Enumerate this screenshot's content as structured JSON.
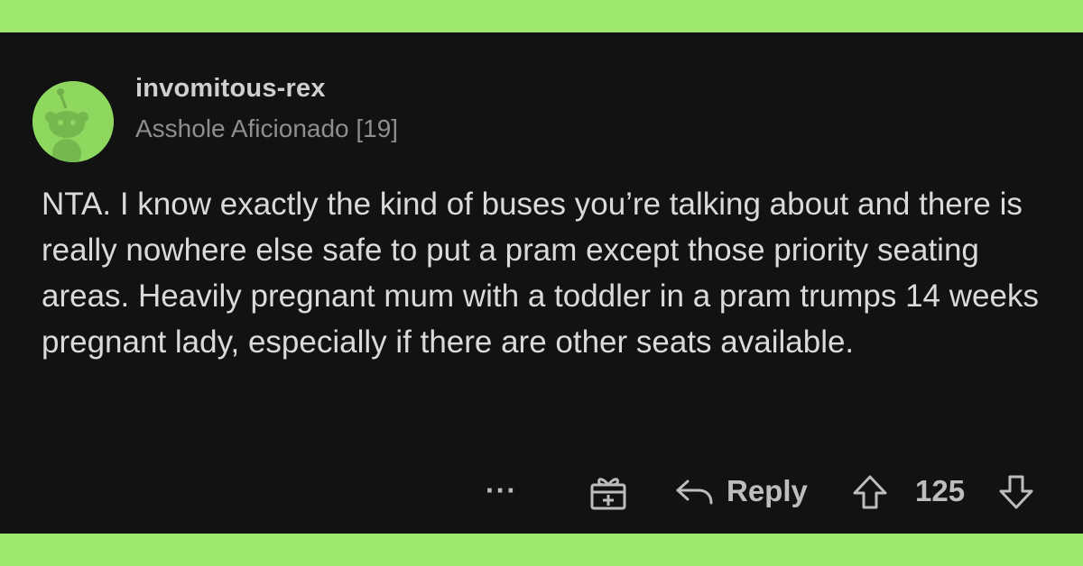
{
  "comment": {
    "username": "invomitous-rex",
    "flair": "Asshole Aficionado [19]",
    "body": "NTA. I know exactly the kind of buses you’re talking about and there is really nowhere else safe to put a pram except those priority seating areas. Heavily pregnant mum with a toddler in a pram trumps 14 weeks pregnant lady, especially if there are other seats available.",
    "avatar_icon": "snoo-avatar-icon"
  },
  "actions": {
    "more_label": "···",
    "reply_label": "Reply",
    "score": "125",
    "icons": [
      "more-icon",
      "award-icon",
      "reply-arrow-icon",
      "upvote-icon",
      "downvote-icon"
    ]
  },
  "colors": {
    "border_green": "#9ee86f",
    "background": "#121212",
    "username": "#cfcfcf",
    "flair": "#8e8e8e",
    "body_text": "#dadada",
    "action_text": "#bdbdbd",
    "avatar_bg": "#8ed860"
  }
}
